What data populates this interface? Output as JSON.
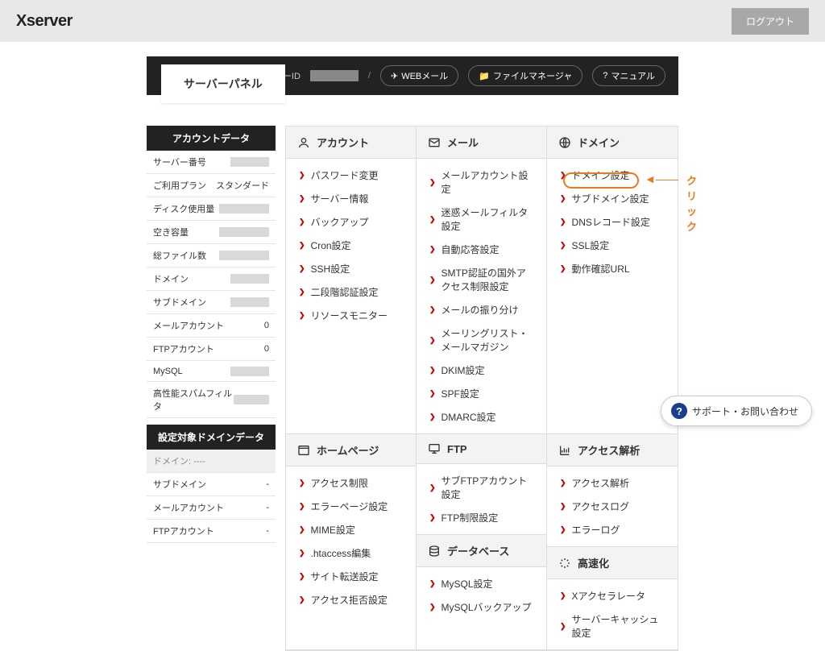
{
  "brand": "Xserver",
  "logout": "ログアウト",
  "panel_title": "サーバーパネル",
  "header": {
    "server_id_label": "サーバーID",
    "webmail": "WEBメール",
    "filemanager": "ファイルマネージャ",
    "manual": "マニュアル"
  },
  "sidebar": {
    "account_data_title": "アカウントデータ",
    "rows": [
      {
        "label": "サーバー番号",
        "masked": true
      },
      {
        "label": "ご利用プラン",
        "value": "スタンダード"
      },
      {
        "label": "ディスク使用量",
        "masked": true,
        "wide": true
      },
      {
        "label": "空き容量",
        "masked": true,
        "wide": true
      },
      {
        "label": "総ファイル数",
        "masked": true,
        "wide": true
      },
      {
        "label": "ドメイン",
        "masked": true
      },
      {
        "label": "サブドメイン",
        "masked": true
      },
      {
        "label": "メールアカウント",
        "value": "0"
      },
      {
        "label": "FTPアカウント",
        "value": "0"
      },
      {
        "label": "MySQL",
        "masked": true
      },
      {
        "label": "高性能スパムフィルタ",
        "masked": true
      }
    ],
    "domain_data_title": "設定対象ドメインデータ",
    "domain_current": "ドメイン: ----",
    "domain_rows": [
      {
        "label": "サブドメイン",
        "value": "-"
      },
      {
        "label": "メールアカウント",
        "value": "-"
      },
      {
        "label": "FTPアカウント",
        "value": "-"
      }
    ]
  },
  "categories": {
    "account": {
      "title": "アカウント",
      "items": [
        "パスワード変更",
        "サーバー情報",
        "バックアップ",
        "Cron設定",
        "SSH設定",
        "二段階認証設定",
        "リソースモニター"
      ]
    },
    "mail": {
      "title": "メール",
      "items": [
        "メールアカウント設定",
        "迷惑メールフィルタ設定",
        "自動応答設定",
        "SMTP認証の国外アクセス制限設定",
        "メールの振り分け",
        "メーリングリスト・メールマガジン",
        "DKIM設定",
        "SPF設定",
        "DMARC設定"
      ]
    },
    "domain": {
      "title": "ドメイン",
      "items": [
        "ドメイン設定",
        "サブドメイン設定",
        "DNSレコード設定",
        "SSL設定",
        "動作確認URL"
      ]
    },
    "homepage": {
      "title": "ホームページ",
      "items": [
        "アクセス制限",
        "エラーページ設定",
        "MIME設定",
        ".htaccess編集",
        "サイト転送設定",
        "アクセス拒否設定"
      ]
    },
    "ftp": {
      "title": "FTP",
      "items": [
        "サブFTPアカウント設定",
        "FTP制限設定"
      ]
    },
    "access": {
      "title": "アクセス解析",
      "items": [
        "アクセス解析",
        "アクセスログ",
        "エラーログ"
      ]
    },
    "database": {
      "title": "データベース",
      "items": [
        "MySQL設定",
        "MySQLバックアップ"
      ]
    },
    "speed": {
      "title": "高速化",
      "items": [
        "Xアクセラレータ",
        "サーバーキャッシュ設定"
      ]
    }
  },
  "annotation": {
    "text": "クリック"
  },
  "support": "サポート・お問い合わせ"
}
